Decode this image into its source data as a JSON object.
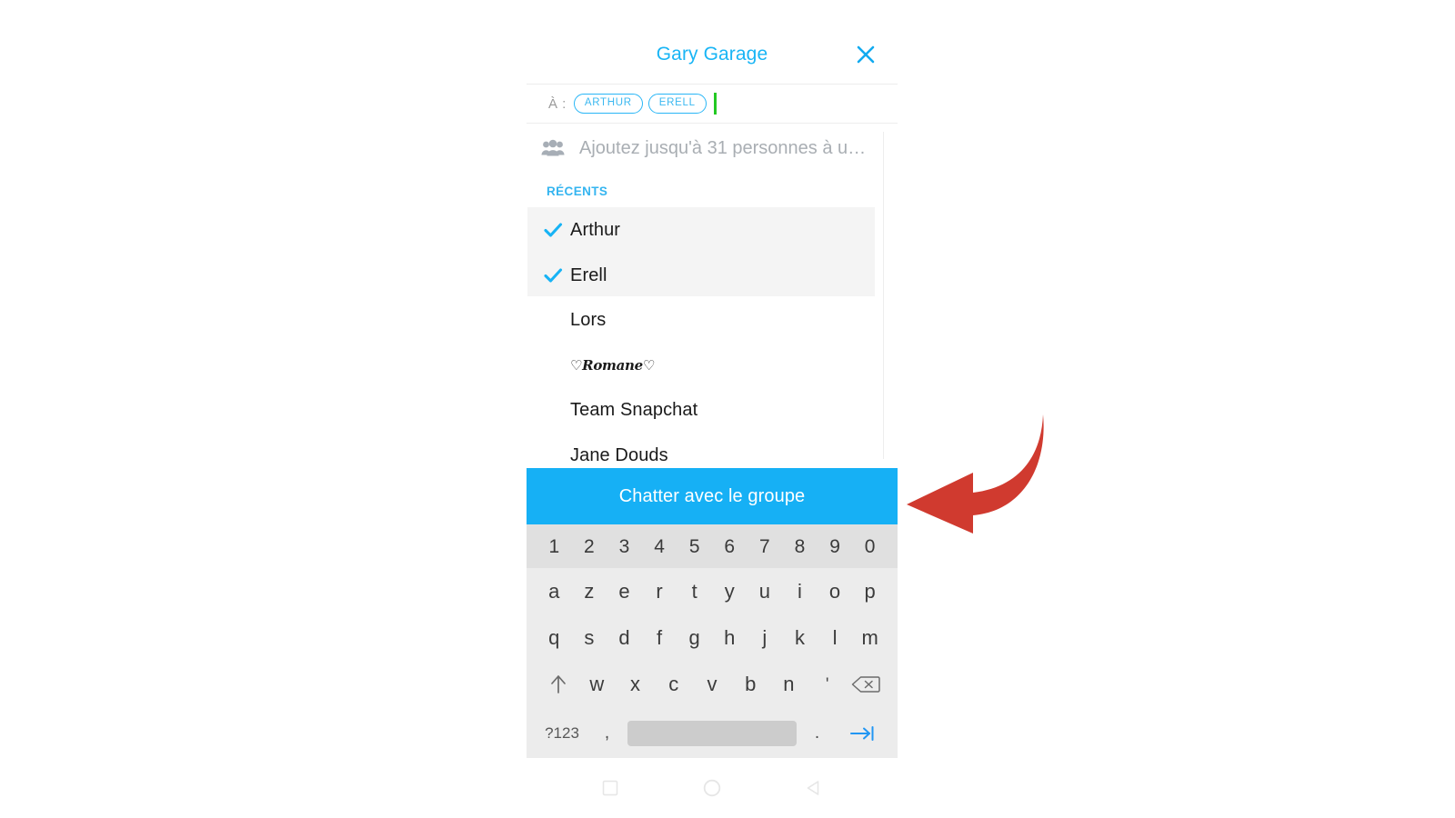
{
  "header": {
    "title": "Gary Garage",
    "close_icon": "close-x-icon"
  },
  "recipients": {
    "label": "À :",
    "chips": [
      "ARTHUR",
      "ERELL"
    ]
  },
  "hint": {
    "icon": "group-people-icon",
    "text": "Ajoutez jusqu'à 31 personnes à u…"
  },
  "recents": {
    "section_label": "RÉCENTS",
    "items": [
      {
        "name": "Arthur",
        "selected": true
      },
      {
        "name": "Erell",
        "selected": true
      },
      {
        "name": "Lors",
        "selected": false
      },
      {
        "name": "♡Romane♡",
        "selected": false,
        "script": true
      },
      {
        "name": "Team Snapchat",
        "selected": false
      },
      {
        "name": "Jane Douds",
        "selected": false
      }
    ]
  },
  "cta": {
    "label": "Chatter avec le groupe"
  },
  "keyboard": {
    "number_row": [
      "1",
      "2",
      "3",
      "4",
      "5",
      "6",
      "7",
      "8",
      "9",
      "0"
    ],
    "row1": [
      "a",
      "z",
      "e",
      "r",
      "t",
      "y",
      "u",
      "i",
      "o",
      "p"
    ],
    "row2": [
      "q",
      "s",
      "d",
      "f",
      "g",
      "h",
      "j",
      "k",
      "l",
      "m"
    ],
    "row3": [
      "w",
      "x",
      "c",
      "v",
      "b",
      "n",
      "'"
    ],
    "shift_icon": "shift-up-arrow-icon",
    "backspace_icon": "backspace-delete-icon",
    "symbols_key": "?123",
    "comma_key": ",",
    "period_key": ".",
    "space_key": "spacebar",
    "enter_icon": "tab-enter-arrow-icon"
  },
  "navbar": {
    "recents_icon": "square-recents-icon",
    "home_icon": "circle-home-icon",
    "back_icon": "triangle-back-icon"
  },
  "annotation": {
    "arrow_icon": "red-curved-left-arrow",
    "color": "#d03a2f"
  },
  "colors": {
    "accent": "#16b0f5",
    "header_title": "#19b5f5",
    "section_label": "#35b5f0",
    "check": "#17b3f5",
    "caret": "#24c924",
    "selection_band": "#f4f4f4",
    "keyboard_bg": "#ececec",
    "number_row_bg": "#e0e0e0",
    "spacebar": "#cccccc"
  }
}
